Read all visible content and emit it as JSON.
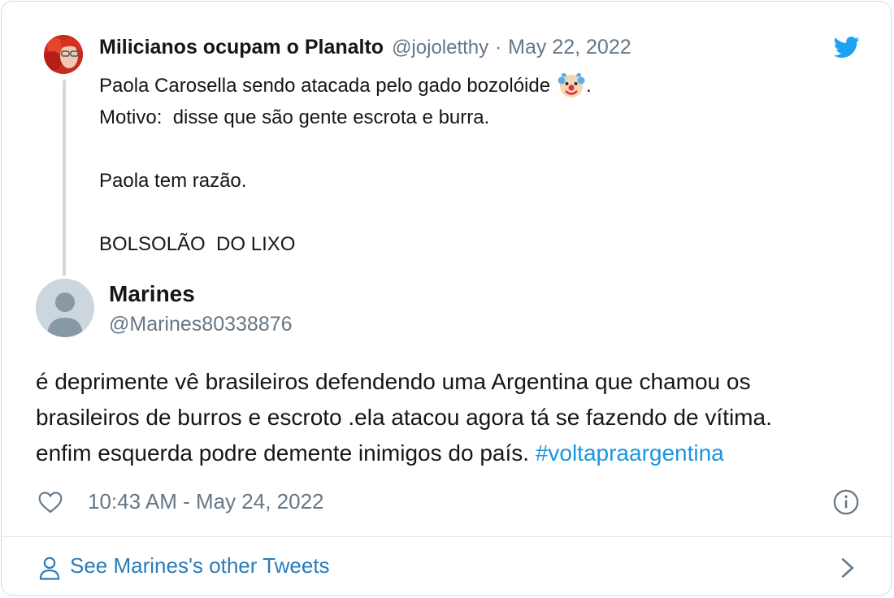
{
  "parent_tweet": {
    "author_name": "Milicianos ocupam o Planalto",
    "author_handle": "@jojoletthy",
    "separator": "·",
    "date": "May 22, 2022",
    "lines": [
      "Paola Carosella sendo atacada pelo gado bozolóide",
      "Motivo:  disse que são gente escrota e burra.",
      "",
      "Paola tem razão.",
      "",
      "BOLSOLÃO  DO LIXO"
    ],
    "line1_suffix": ".",
    "emoji": "clown-face-emoji"
  },
  "tweet": {
    "author_name": "Marines",
    "author_handle": "@Marines80338876",
    "text_lines": [
      "é deprimente vê brasileiros defendendo uma Argentina que chamou os",
      "brasileiros de burros e escroto .ela atacou agora tá se fazendo de vítima.",
      "enfim esquerda podre demente inimigos do país. "
    ],
    "hashtag": "#voltapraargentina",
    "timestamp": "10:43 AM - May 24, 2022"
  },
  "footer": {
    "label": "See Marines's other Tweets"
  },
  "colors": {
    "twitter_blue": "#1da1f2",
    "link_blue": "#1b95e0",
    "secondary_text": "#657786",
    "border": "#cfd9de"
  },
  "icons": [
    "twitter-bird-icon",
    "heart-icon",
    "info-icon",
    "user-icon",
    "chevron-right-icon"
  ]
}
